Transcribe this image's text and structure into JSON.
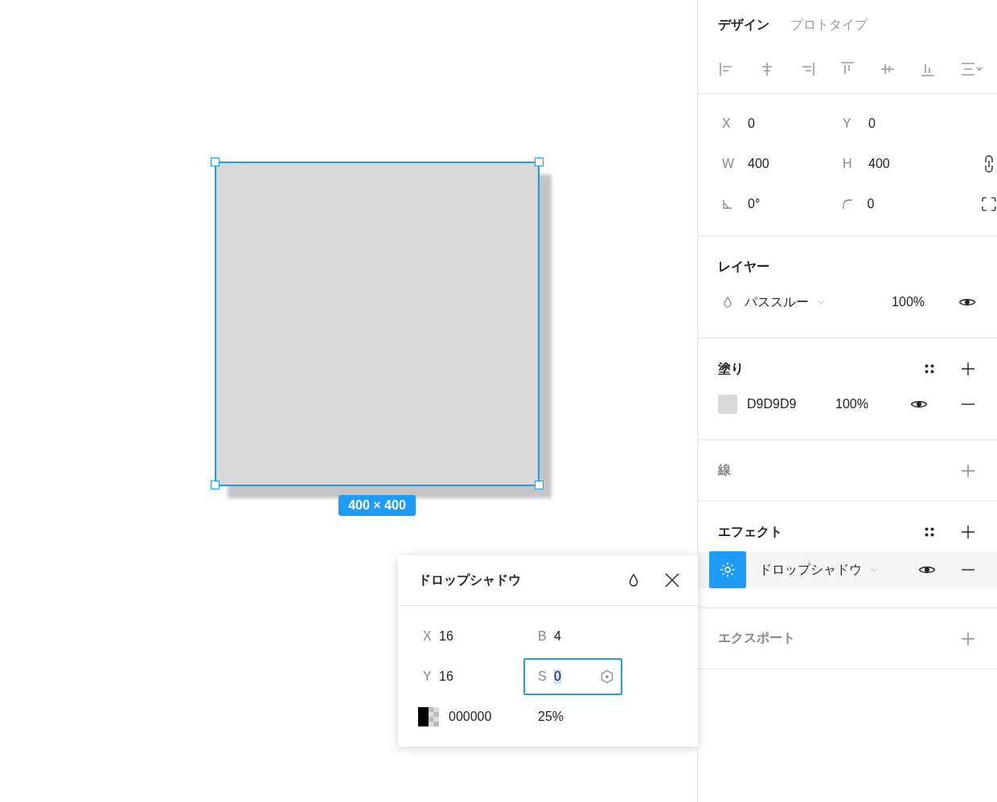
{
  "canvas": {
    "selected": true,
    "size_label": "400 × 400"
  },
  "tabs": [
    {
      "label": "デザイン",
      "selected": true
    },
    {
      "label": "プロトタイプ",
      "selected": false
    }
  ],
  "transform": {
    "fields": [
      {
        "kind": "letter",
        "label": "X",
        "value": "0"
      },
      {
        "kind": "letter",
        "label": "Y",
        "value": "0"
      },
      {
        "kind": "letter",
        "label": "W",
        "value": "400"
      },
      {
        "kind": "letter",
        "label": "H",
        "value": "400"
      },
      {
        "kind": "angle",
        "value": "0°"
      },
      {
        "kind": "corner",
        "value": "0"
      }
    ]
  },
  "layer": {
    "title": "レイヤー",
    "blend": "パススルー",
    "opacity": "100%",
    "visible": true
  },
  "fill": {
    "title": "塗り",
    "empty": false,
    "items": [
      {
        "color": "#d9d9d9",
        "hex": "D9D9D9",
        "opacity": "100%",
        "visible": true
      }
    ]
  },
  "stroke": {
    "title": "線",
    "empty": true
  },
  "effects": {
    "title": "エフェクト",
    "empty": false,
    "items": [
      {
        "name": "ドロップシャドウ",
        "visible": true,
        "selected": true
      }
    ]
  },
  "export": {
    "title": "エクスポート",
    "empty": true
  },
  "popup": {
    "title": "ドロップシャドウ",
    "fields": [
      {
        "label": "X",
        "value": "16",
        "focused": false
      },
      {
        "label": "B",
        "value": "4",
        "focused": false
      },
      {
        "label": "Y",
        "value": "16",
        "focused": false
      },
      {
        "label": "S",
        "value": "0",
        "focused": true
      }
    ],
    "hex": "000000",
    "opacity": "25%"
  }
}
